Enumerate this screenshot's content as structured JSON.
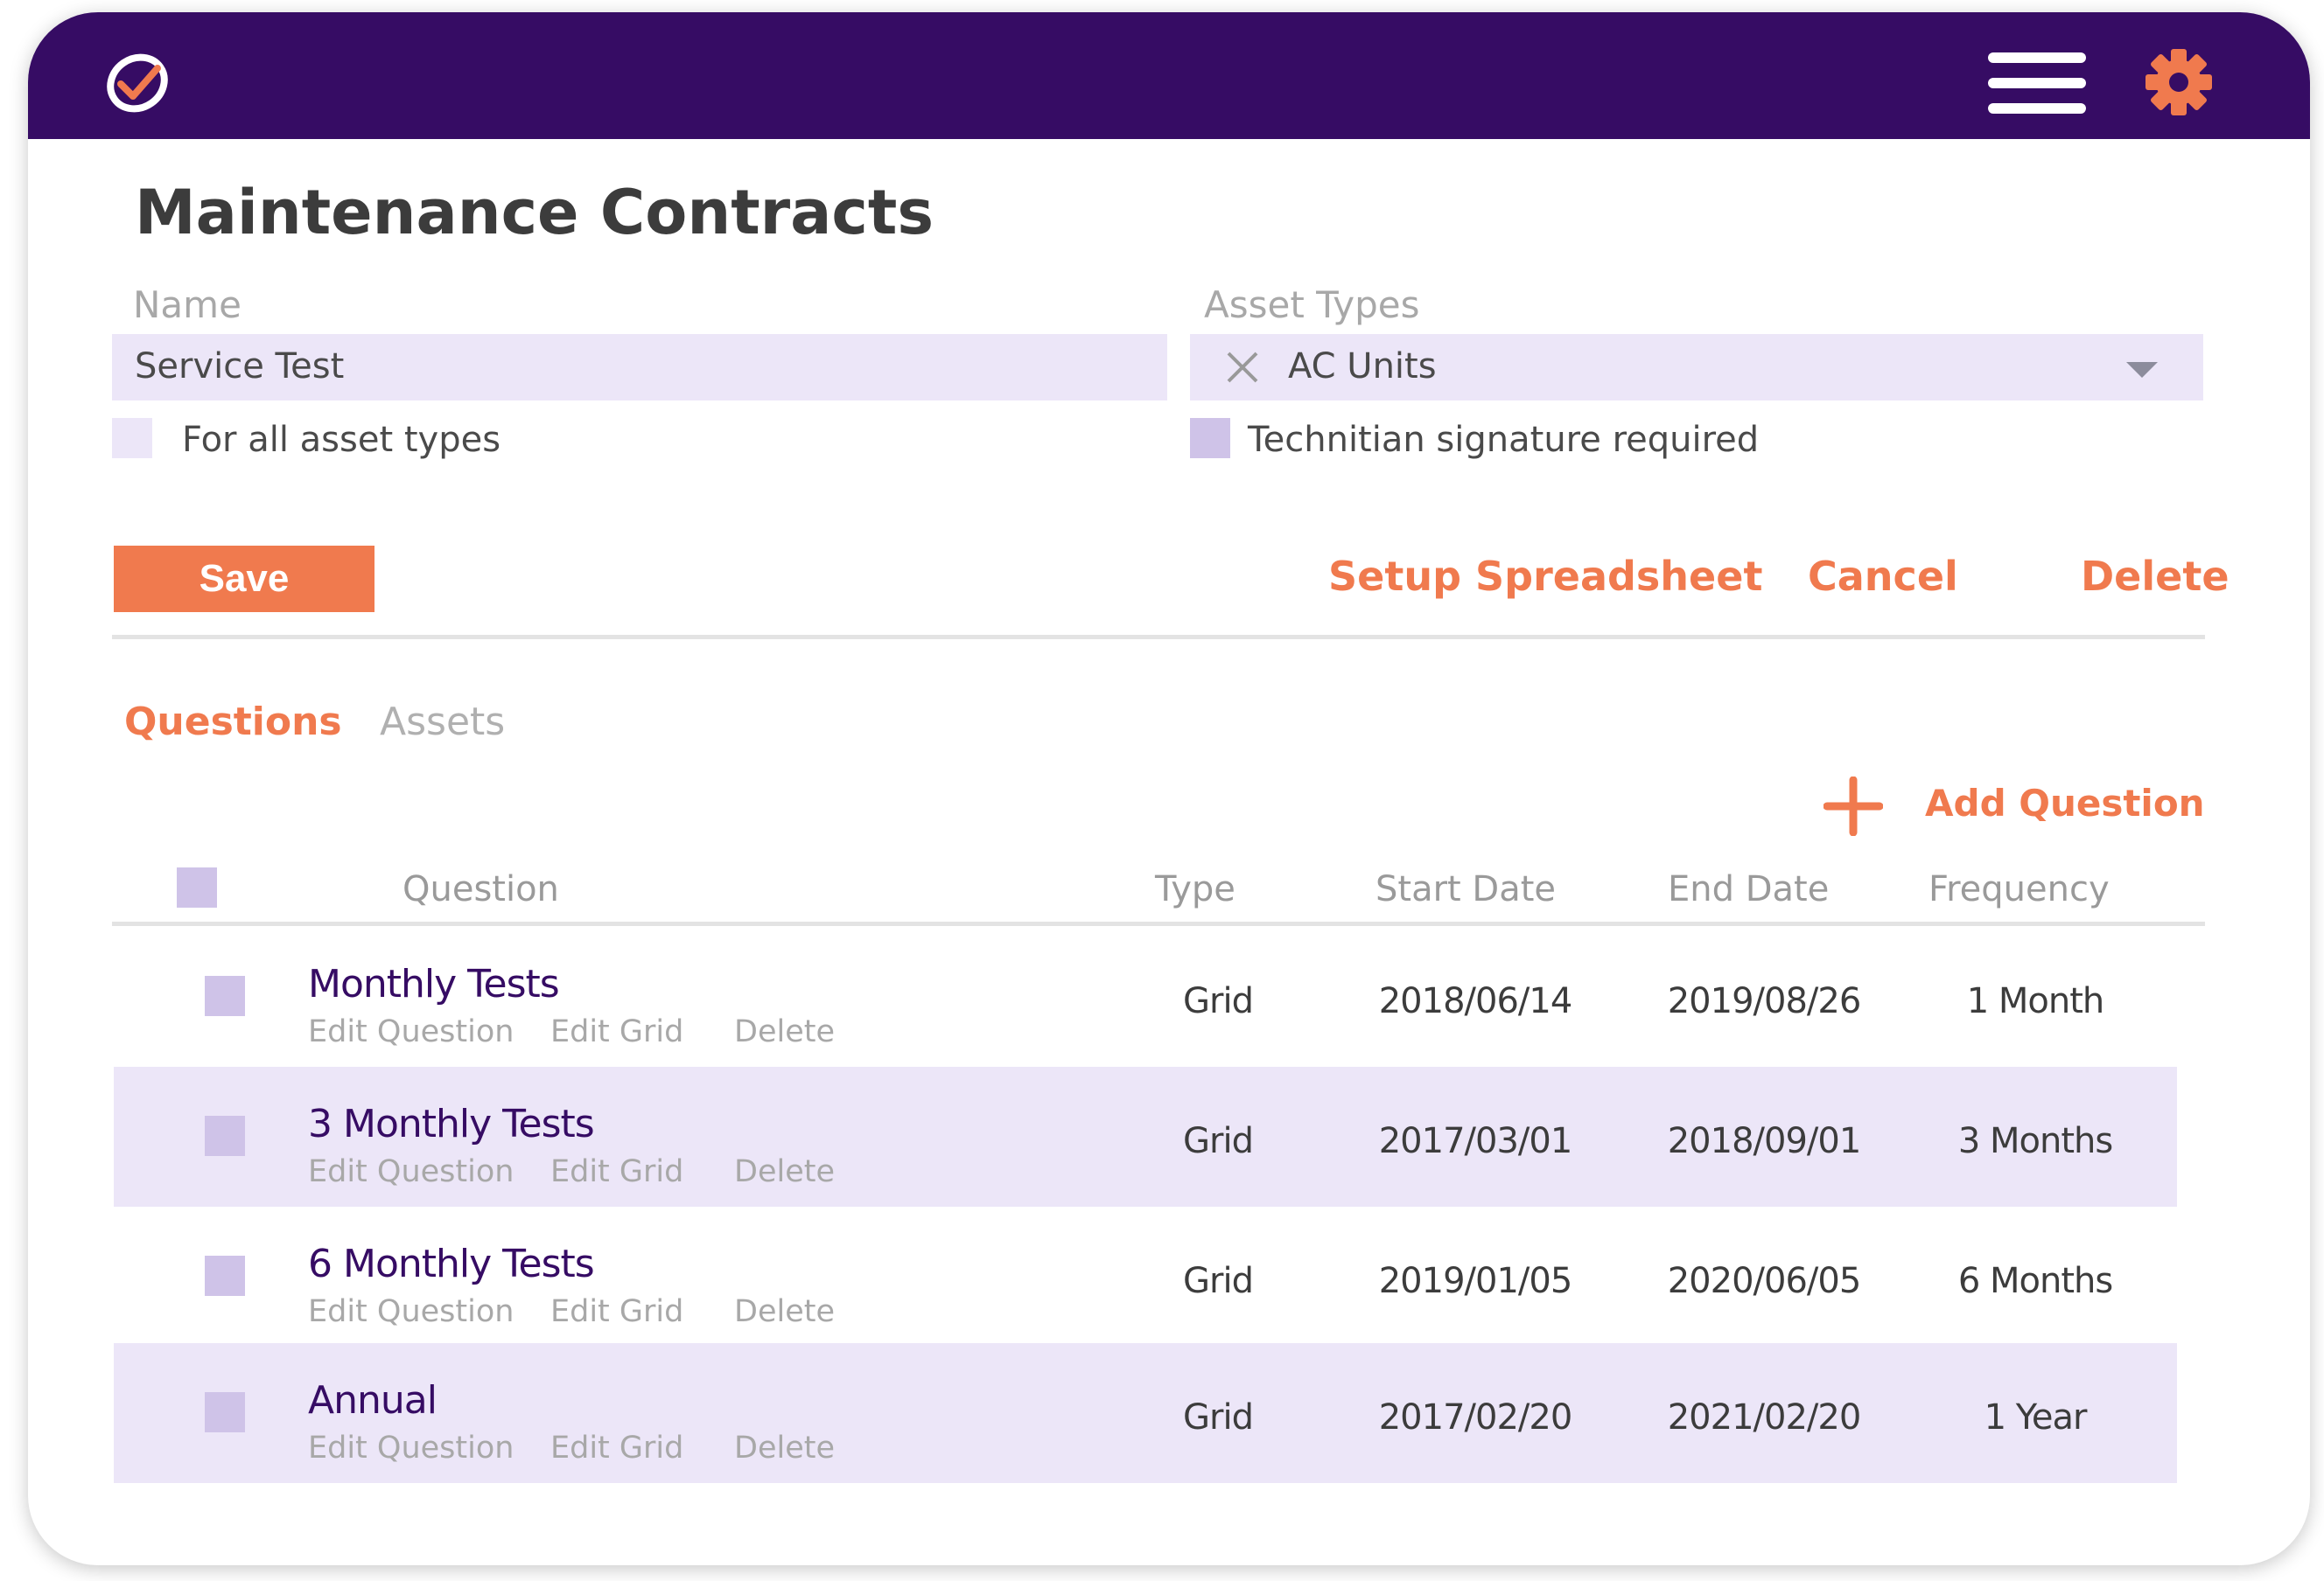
{
  "header": {
    "logo_icon": "check-circle-logo-icon",
    "menu_icon": "hamburger-menu-icon",
    "settings_icon": "gear-icon",
    "bg_color": "#360c64",
    "accent_color": "#f07a4e"
  },
  "page_title": "Maintenance Contracts",
  "form": {
    "name_label": "Name",
    "name_value": "Service Test",
    "asset_types_label": "Asset Types",
    "asset_types_value": "AC Units",
    "for_all_label": "For all asset types",
    "signature_label": "Technitian signature required"
  },
  "actions": {
    "save": "Save",
    "setup_spreadsheet": "Setup Spreadsheet",
    "cancel": "Cancel",
    "delete": "Delete"
  },
  "tabs": [
    {
      "label": "Questions",
      "active": true
    },
    {
      "label": "Assets",
      "active": false
    }
  ],
  "add_question": "Add Question",
  "table": {
    "headers": [
      "Question",
      "Type",
      "Start Date",
      "End Date",
      "Frequency"
    ],
    "row_links": [
      "Edit Question",
      "Edit Grid",
      "Delete"
    ],
    "rows": [
      {
        "question": "Monthly Tests",
        "type": "Grid",
        "start": "2018/06/14",
        "end": "2019/08/26",
        "frequency": "1 Month"
      },
      {
        "question": "3 Monthly Tests",
        "type": "Grid",
        "start": "2017/03/01",
        "end": "2018/09/01",
        "frequency": "3 Months"
      },
      {
        "question": "6 Monthly Tests",
        "type": "Grid",
        "start": "2019/01/05",
        "end": "2020/06/05",
        "frequency": "6 Months"
      },
      {
        "question": "Annual",
        "type": "Grid",
        "start": "2017/02/20",
        "end": "2021/02/20",
        "frequency": "1 Year"
      }
    ]
  }
}
